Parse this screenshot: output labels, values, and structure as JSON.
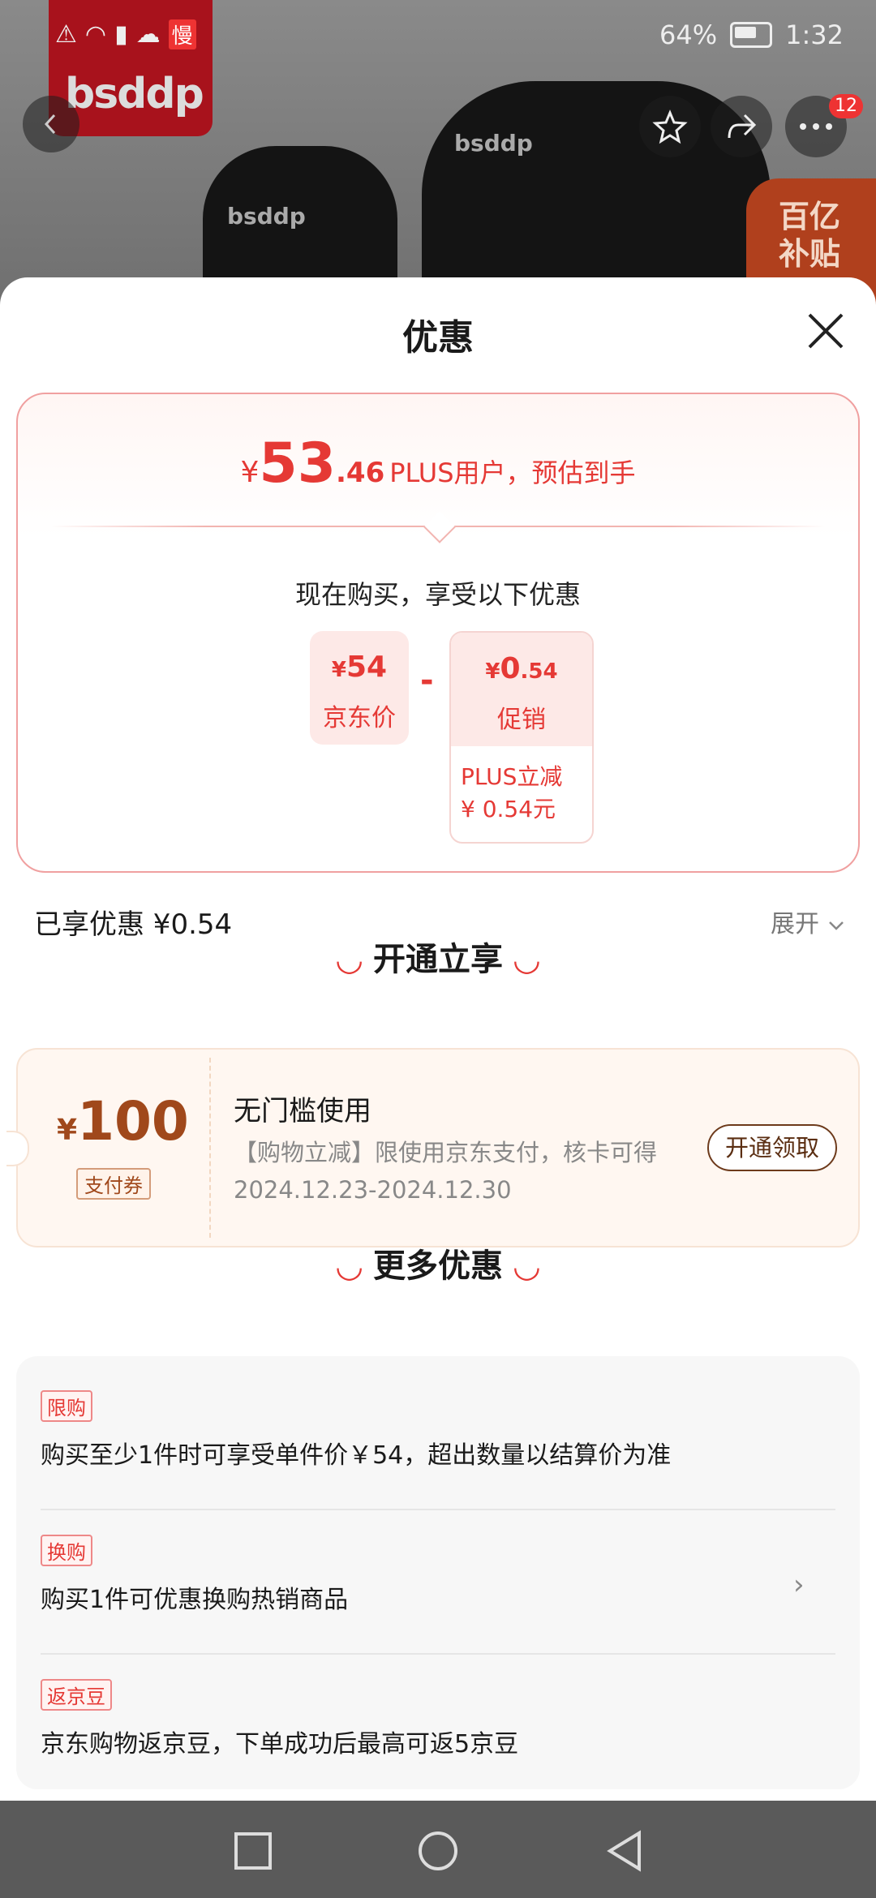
{
  "status_bar": {
    "battery": "64%",
    "time": "1:32",
    "slow_badge": "慢"
  },
  "backdrop": {
    "brand": "bsddp",
    "pad_logo": "bsddp",
    "subsidy_line1": "百亿",
    "subsidy_line2": "补贴",
    "cart_badge": "12"
  },
  "sheet": {
    "title": "优惠"
  },
  "price_card": {
    "currency": "¥",
    "integer": "53",
    "decimal": ".46",
    "note": "PLUS用户，预估到手",
    "now_buy": "现在购买，享受以下优惠",
    "jd_price_value": "54",
    "jd_price_label": "京东价",
    "minus": "-",
    "promo_value_int": "0",
    "promo_value_dec": ".54",
    "promo_label": "促销",
    "promo_detail_line1": "PLUS立减",
    "promo_detail_line2": "¥ 0.54元"
  },
  "enjoyed": {
    "text": "已享优惠 ¥0.54",
    "expand_label": "展开"
  },
  "open_section": {
    "title": "开通立享"
  },
  "coupon": {
    "currency": "¥",
    "amount": "100",
    "tag": "支付券",
    "title": "无门槛使用",
    "desc": "【购物立减】限使用京东支付，核卡可得",
    "date": "2024.12.23-2024.12.30",
    "button": "开通领取"
  },
  "more_section": {
    "title": "更多优惠"
  },
  "offers": [
    {
      "tag": "限购",
      "text": "购买至少1件时可享受单件价￥54，超出数量以结算价为准"
    },
    {
      "tag": "换购",
      "text": "购买1件可优惠换购热销商品"
    },
    {
      "tag": "返京豆",
      "text": "京东购物返京豆，下单成功后最高可返5京豆"
    }
  ],
  "colors": {
    "accent_red": "#e53935",
    "coupon_brown": "#a0481b"
  }
}
